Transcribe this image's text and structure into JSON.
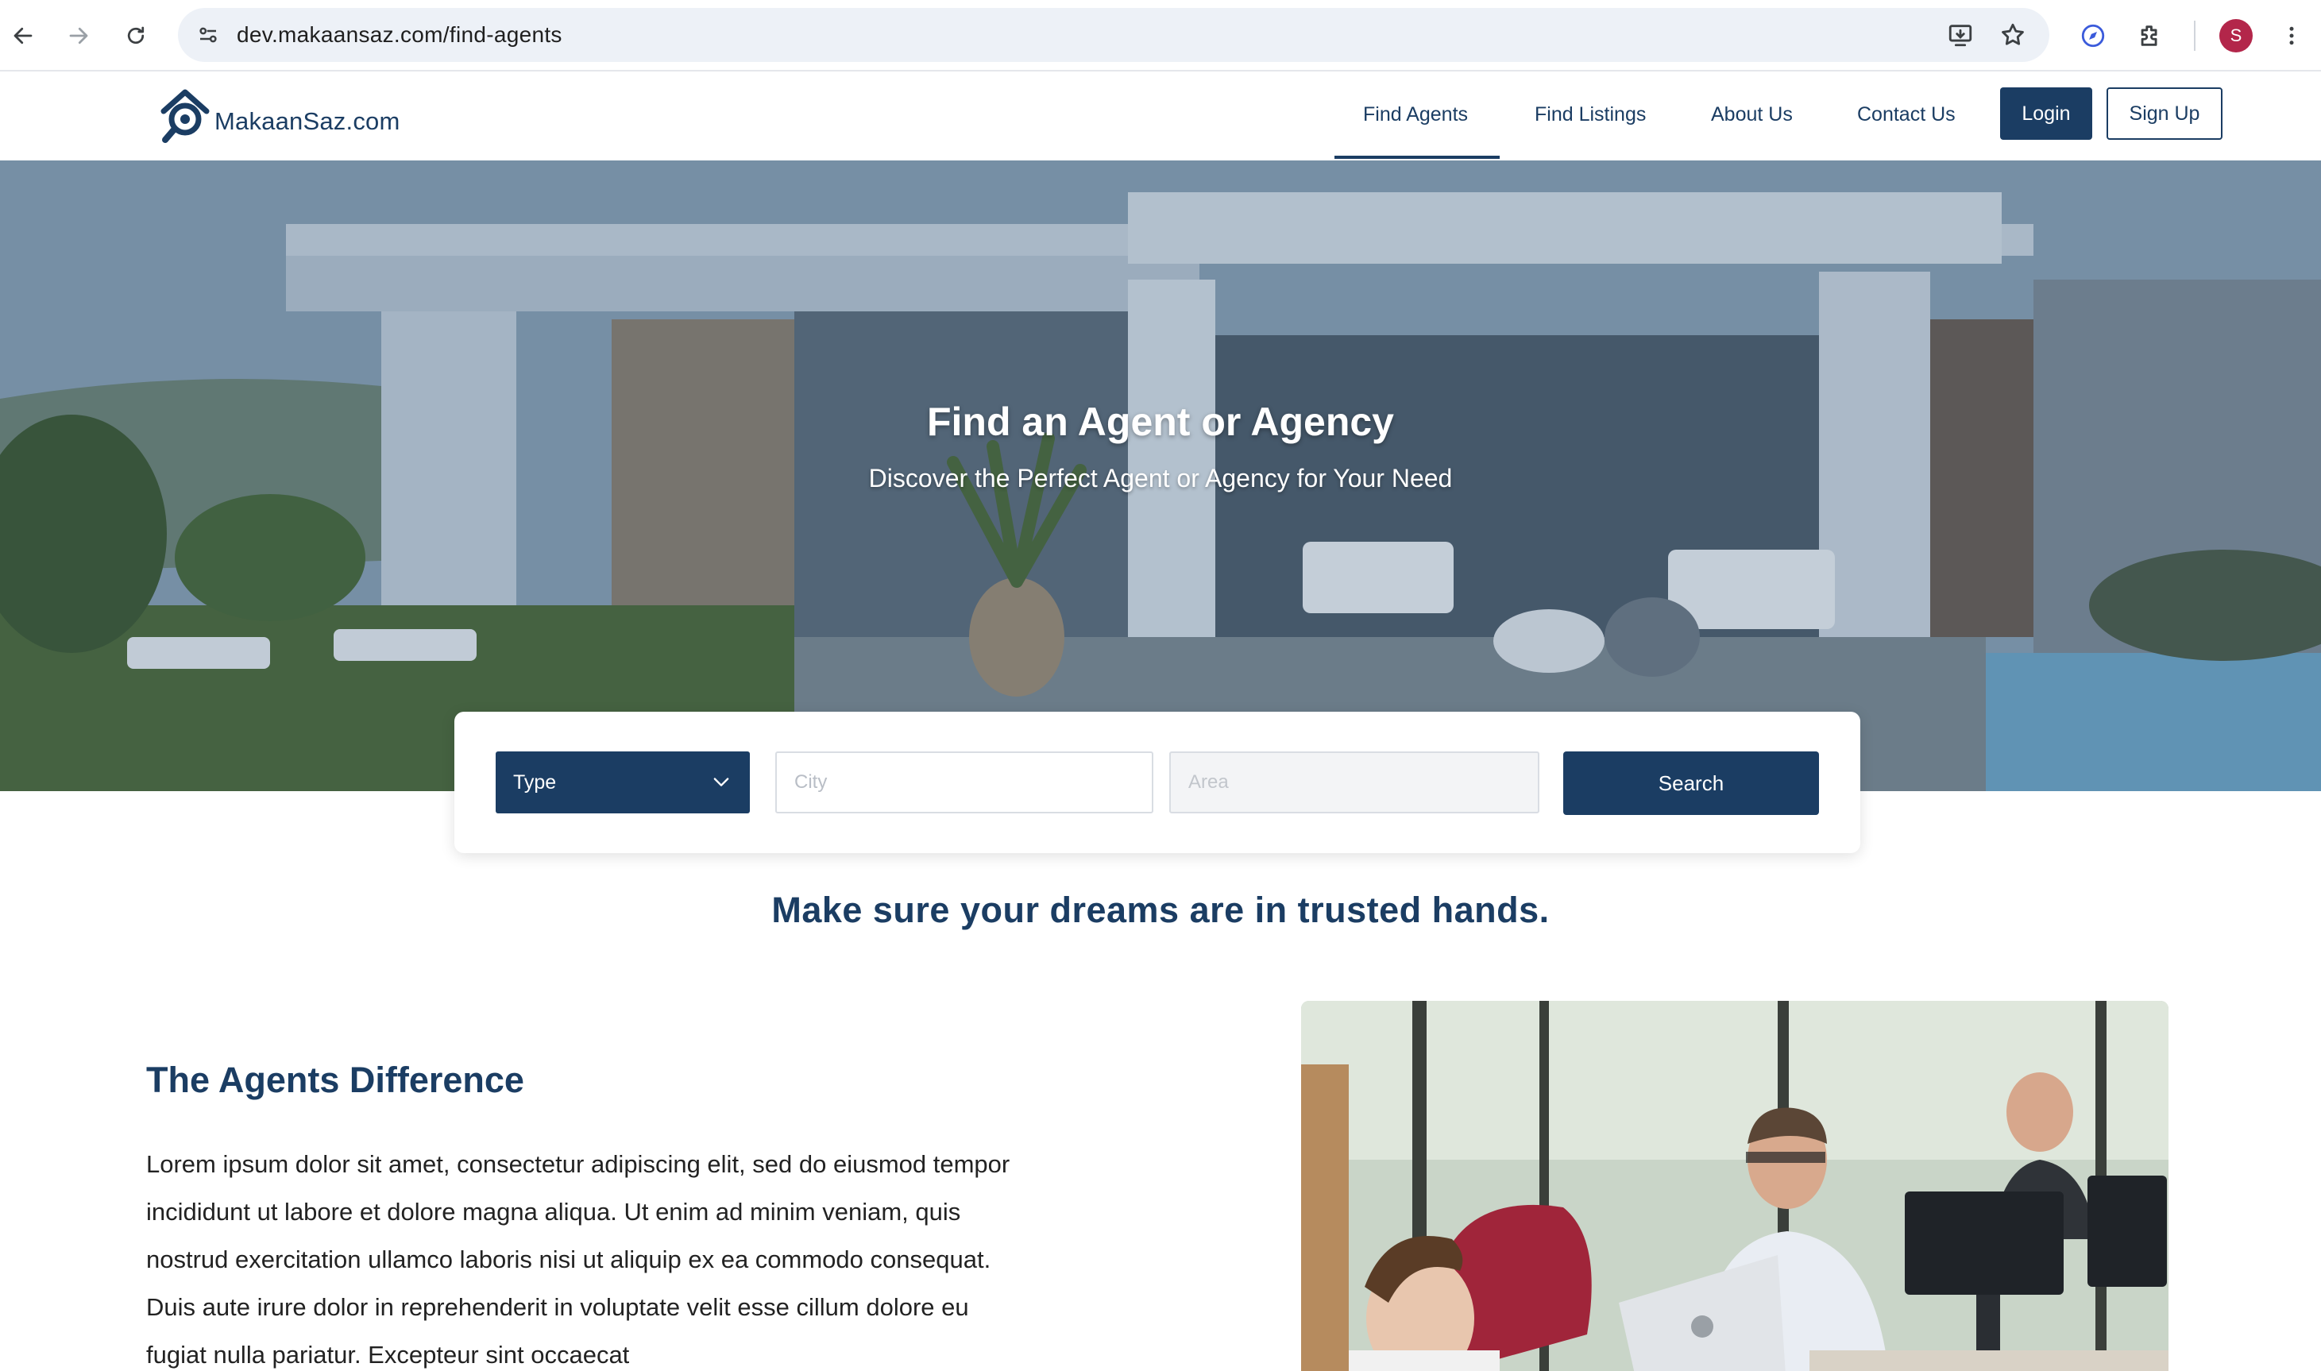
{
  "browser": {
    "url": "dev.makaansaz.com/find-agents",
    "profile_initial": "S"
  },
  "site": {
    "logo_text": "MakaanSaz.com",
    "nav": [
      {
        "label": "Find Agents",
        "active": true
      },
      {
        "label": "Find Listings",
        "active": false
      },
      {
        "label": "About Us",
        "active": false
      },
      {
        "label": "Contact Us",
        "active": false
      }
    ],
    "login_label": "Login",
    "signup_label": "Sign Up"
  },
  "hero": {
    "title": "Find an Agent or Agency",
    "subtitle": "Discover the Perfect Agent or Agency for Your Need"
  },
  "search": {
    "type_selected": "Type",
    "city_placeholder": "City",
    "area_placeholder": "Area",
    "button_label": "Search"
  },
  "content": {
    "tagline": "Make sure your dreams are in trusted hands.",
    "section_title": "The Agents Difference",
    "body": "Lorem ipsum dolor sit amet, consectetur adipiscing elit, sed do eiusmod tempor incididunt ut labore et dolore magna aliqua. Ut enim ad minim veniam, quis nostrud exercitation ullamco laboris nisi ut aliquip ex ea commodo consequat. Duis aute irure dolor in reprehenderit in voluptate velit esse cillum dolore eu fugiat nulla pariatur. Excepteur sint occaecat"
  },
  "colors": {
    "brand_navy": "#1b3d63",
    "profile_avatar": "#b3264a"
  }
}
